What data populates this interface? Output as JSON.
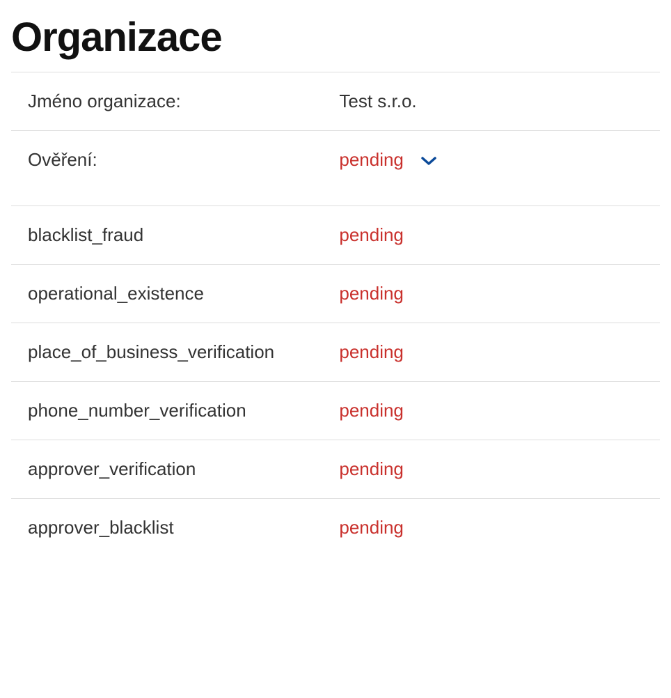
{
  "title": "Organizace",
  "rows": {
    "orgName": {
      "label": "Jméno organizace:",
      "value": "Test s.r.o."
    },
    "overeni": {
      "label": "Ověření:",
      "value": "pending"
    }
  },
  "checks": [
    {
      "label": "blacklist_fraud",
      "value": "pending"
    },
    {
      "label": "operational_existence",
      "value": "pending"
    },
    {
      "label": "place_of_business_verification",
      "value": "pending"
    },
    {
      "label": "phone_number_verification",
      "value": "pending"
    },
    {
      "label": "approver_verification",
      "value": "pending"
    },
    {
      "label": "approver_blacklist",
      "value": "pending"
    }
  ]
}
